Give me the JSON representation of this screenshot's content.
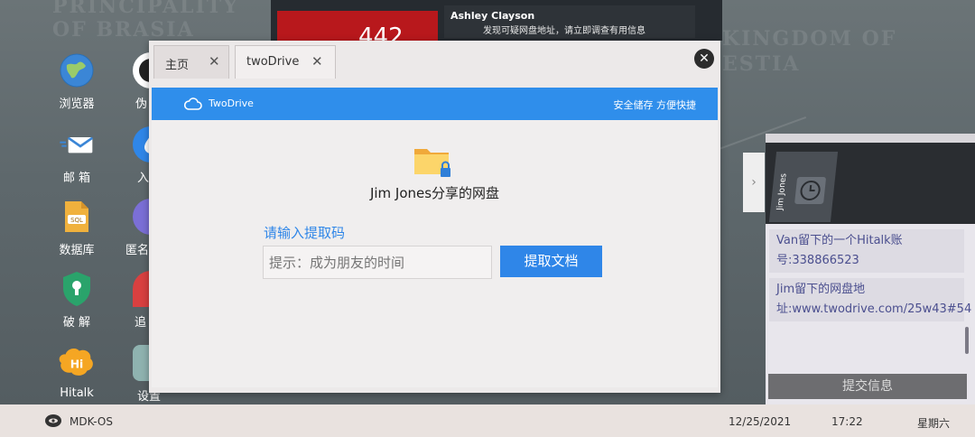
{
  "desktop": {
    "icons": [
      {
        "label": "浏览器",
        "icon": "globe-icon"
      },
      {
        "label": "邮 箱",
        "icon": "mail-icon"
      },
      {
        "label": "数据库",
        "icon": "database-sql-icon"
      },
      {
        "label": "破 解",
        "icon": "shield-keyhole-icon"
      },
      {
        "label": "Hitalk",
        "icon": "hitalk-icon"
      },
      {
        "label": "伪",
        "icon": "mask-icon"
      },
      {
        "label": "入",
        "icon": "fingerprint-icon"
      },
      {
        "label": "匿名",
        "icon": "anonymous-icon"
      },
      {
        "label": "追",
        "icon": "location-pin-icon"
      },
      {
        "label": "设置",
        "icon": "settings-icon"
      }
    ]
  },
  "notification": {
    "counter": "442",
    "sender": "Ashley Clayson",
    "message": "发现可疑网盘地址，请立即调查有用信息"
  },
  "window": {
    "tabs": [
      {
        "label": "主页"
      },
      {
        "label": "twoDrive"
      }
    ],
    "close_glyph": "✕",
    "brand": "TwoDrive",
    "slogan": "安全储存  方便快捷",
    "share_title": "Jim Jones分享的网盘",
    "code_label": "请输入提取码",
    "code_placeholder": "提示：成为朋友的时间",
    "fetch_button": "提取文档"
  },
  "right_panel": {
    "card_name": "Jim Jones",
    "items": [
      "Van留下的一个Hitalk账号:338866523",
      "Jim留下的网盘地址:www.twodrive.com/25w43#54"
    ],
    "submit_label": "提交信息"
  },
  "taskbar": {
    "os_name": "MDK-OS",
    "date": "12/25/2021",
    "time": "17:22",
    "day": "星期六"
  },
  "colors": {
    "accent_blue": "#2f86e8",
    "alert_red": "#b8181c",
    "item_text": "#4b4f8f"
  }
}
